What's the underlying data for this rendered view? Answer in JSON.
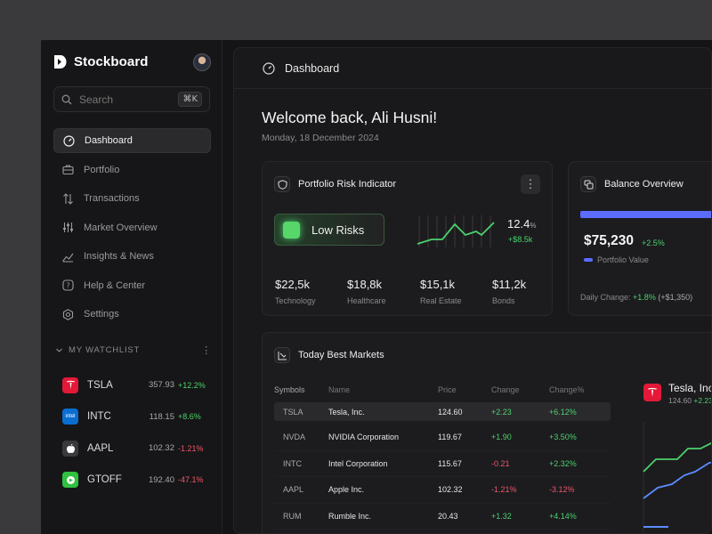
{
  "brand": {
    "name": "Stockboard"
  },
  "search": {
    "placeholder": "Search",
    "shortcut": "⌘K"
  },
  "nav": [
    {
      "label": "Dashboard",
      "icon": "gauge-icon",
      "active": true
    },
    {
      "label": "Portfolio",
      "icon": "briefcase-icon"
    },
    {
      "label": "Transactions",
      "icon": "arrows-updown-icon"
    },
    {
      "label": "Market Overview",
      "icon": "sliders-icon"
    },
    {
      "label": "Insights & News",
      "icon": "chart-line-icon"
    },
    {
      "label": "Help & Center",
      "icon": "help-icon"
    },
    {
      "label": "Settings",
      "icon": "gear-icon"
    }
  ],
  "watchlist": {
    "title": "MY WATCHLIST",
    "items": [
      {
        "symbol": "TSLA",
        "price": "357.93",
        "change": "+12.2%",
        "dir": "up",
        "logo_color": "#e31937",
        "logo_text": "T"
      },
      {
        "symbol": "INTC",
        "price": "118.15",
        "change": "+8.6%",
        "dir": "up",
        "logo_color": "#0a6ed1",
        "logo_text": "intel"
      },
      {
        "symbol": "AAPL",
        "price": "102.32",
        "change": "-1.21%",
        "dir": "down",
        "logo_color": "#3a3a3d",
        "logo_text": ""
      },
      {
        "symbol": "GTOFF",
        "price": "192.40",
        "change": "-47.1%",
        "dir": "down",
        "logo_color": "#2fc13f",
        "logo_text": ""
      }
    ]
  },
  "header": {
    "title": "Dashboard"
  },
  "welcome": {
    "title": "Welcome back, Ali Husni!",
    "date": "Monday, 18 December 2024"
  },
  "risk_card": {
    "title": "Portfolio Risk Indicator",
    "button": "Low Risks",
    "percent": "12.4",
    "percent_unit": "%",
    "gain": "+$8.5k",
    "categories": [
      {
        "value": "$22,5k",
        "label": "Technology"
      },
      {
        "value": "$18,8k",
        "label": "Healthcare"
      },
      {
        "value": "$15,1k",
        "label": "Real Estate"
      },
      {
        "value": "$11,2k",
        "label": "Bonds"
      }
    ]
  },
  "balance_card": {
    "title": "Balance Overview",
    "value": "$75,230",
    "change": "+2.5%",
    "legend": "Portfolio Value",
    "daily_label": "Daily Change:",
    "daily_pct": "+1.8%",
    "daily_abs": "(+$1,350)"
  },
  "markets_card": {
    "title": "Today Best Markets",
    "columns": [
      "Symbols",
      "Name",
      "Price",
      "Change",
      "Change%"
    ],
    "rows": [
      {
        "symbol": "TSLA",
        "name": "Tesla, Inc.",
        "price": "124.60",
        "change": "+2.23",
        "pct": "+6.12%",
        "dir": "up"
      },
      {
        "symbol": "NVDA",
        "name": "NVIDIA Corporation",
        "price": "119.67",
        "change": "+1.90",
        "pct": "+3.50%",
        "dir": "up"
      },
      {
        "symbol": "INTC",
        "name": "Intel Corporation",
        "price": "115.67",
        "change": "-0.21",
        "pct": "+2.32%",
        "dir": "mixed"
      },
      {
        "symbol": "AAPL",
        "name": "Apple Inc.",
        "price": "102.32",
        "change": "-1.21%",
        "pct": "-3.12%",
        "dir": "down"
      },
      {
        "symbol": "RUM",
        "name": "Rumble Inc.",
        "price": "20.43",
        "change": "+1.32",
        "pct": "+4.14%",
        "dir": "up"
      }
    ],
    "detail": {
      "title": "Tesla, Inc",
      "price": "124.60",
      "change": "+2.23"
    }
  },
  "colors": {
    "accent_blue": "#5b6cff",
    "up": "#4cd16a",
    "down": "#f05668"
  }
}
